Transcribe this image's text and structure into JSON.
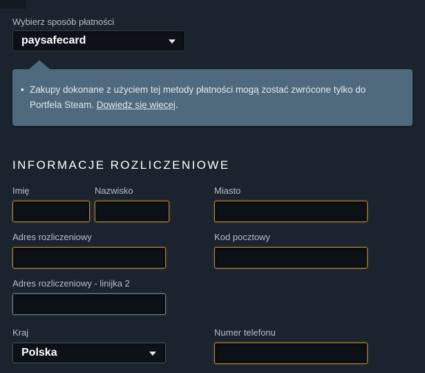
{
  "colors": {
    "page_background": "#1b242e",
    "notice_background": "#4e6a7c",
    "required_field_border": "#bd8a2f",
    "optional_field_border": "#7c8793",
    "heading_text": "#ffffff",
    "label_text": "#b3bfc9"
  },
  "payment_method": {
    "label": "Wybierz sposób płatności",
    "selected_option": "paysafecard"
  },
  "notice": {
    "bullet": "•",
    "message": "Zakupy dokonane z użyciem tej metody płatności mogą zostać zwrócone tylko do Portfela Steam. ",
    "link_label": "Dowiedz się więcej",
    "link_suffix": "."
  },
  "billing": {
    "heading": "INFORMACJE ROZLICZENIOWE",
    "fields": {
      "first_name": {
        "label": "Imię",
        "value": ""
      },
      "last_name": {
        "label": "Nazwisko",
        "value": ""
      },
      "city": {
        "label": "Miasto",
        "value": ""
      },
      "address": {
        "label": "Adres rozliczeniowy",
        "value": ""
      },
      "postal_code": {
        "label": "Kod pocztowy",
        "value": ""
      },
      "address_line2": {
        "label": "Adres rozliczeniowy - linijka 2",
        "value": ""
      },
      "country": {
        "label": "Kraj",
        "selected_option": "Polska"
      },
      "phone": {
        "label": "Numer telefonu",
        "value": ""
      }
    }
  }
}
